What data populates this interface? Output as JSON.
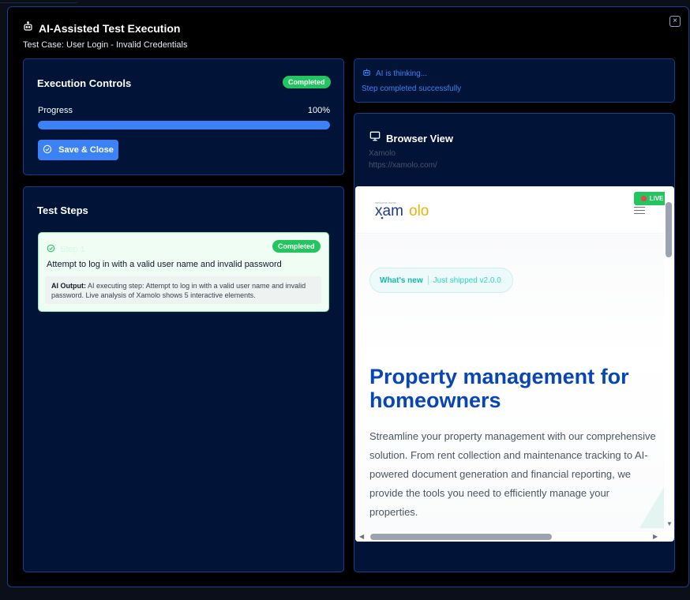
{
  "modal": {
    "title": "AI-Assisted Test Execution",
    "test_case": "Test Case: User Login - Invalid Credentials",
    "close_label": "×"
  },
  "controls": {
    "title": "Execution Controls",
    "status": "Completed",
    "progress_label": "Progress",
    "progress_text": "100%",
    "progress_value": 100,
    "save_button": "Save & Close"
  },
  "steps": {
    "title": "Test Steps",
    "items": [
      {
        "label": "Step 1",
        "status": "Completed",
        "description": "Attempt to log in with a valid user name and invalid password",
        "ai_output_label": "AI Output:",
        "ai_output": "AI executing step: Attempt to log in with a valid user name and invalid password. Live analysis of Xamolo shows 5 interactive elements."
      }
    ]
  },
  "ai_status": {
    "thinking": "AI is thinking...",
    "message": "Step completed successfully"
  },
  "browser": {
    "title": "Browser View",
    "site_name": "Xamolo",
    "url": "https://xamolo.com/",
    "live_label": "LIVE",
    "logo_text": "xamolo",
    "pill_label": "What's new",
    "pill_text": "Just shipped v2.0.0",
    "hero_title": "Property management for homeowners",
    "hero_body": "Streamline your property management with our comprehensive solution. From rent collection and maintenance tracking to AI-powered document generation and financial reporting, we provide the tools you need to efficiently manage your properties."
  },
  "colors": {
    "accent": "#3b82f6",
    "success": "#22c55e",
    "panel": "#011438",
    "brand_blue": "#0845b5",
    "brand_teal": "#14b8a6"
  }
}
